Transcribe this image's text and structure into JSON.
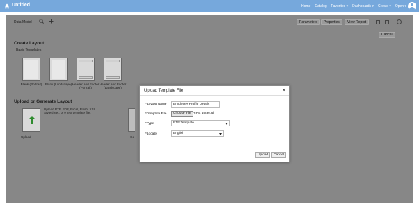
{
  "topbar": {
    "title": "Untitled",
    "nav": [
      "Home",
      "Catalog",
      "Favorites ▾",
      "Dashboards ▾",
      "Create ▾",
      "Open ▾"
    ]
  },
  "toolbar": {
    "data_model_label": "Data Model",
    "parameters": "Parameters",
    "properties": "Properties",
    "view_report": "View Report",
    "cancel": "Cancel"
  },
  "create_layout": {
    "title": "Create Layout",
    "subtitle": "Basic Templates",
    "templates": [
      {
        "label": "Blank (Portrait)"
      },
      {
        "label": "Blank (Landscape)"
      },
      {
        "label": "Header and Footer (Portrait)"
      },
      {
        "label": "Header and Footer (Landscape)"
      }
    ]
  },
  "upload_section": {
    "title": "Upload or Generate Layout",
    "description": "Upload RTF, PDF, Excel, Flash, XSL Stylesheet, or eText template file.",
    "upload_label": "Upload",
    "generate_label": "Ge"
  },
  "dialog": {
    "title": "Upload Template File",
    "layout_name_label": "*Layout Name",
    "layout_name_value": "Employee Profile Details",
    "template_file_label": "*Template File",
    "choose_file_label": "Choose File",
    "file_name": "HIRE Letter.rtf",
    "type_label": "*Type",
    "type_value": "RTF Template",
    "locale_label": "*Locale",
    "locale_value": "English",
    "upload_button": "Upload",
    "cancel_button": "Cancel"
  },
  "colors": {
    "topbar": "#76a8dc",
    "overlay": "#878787",
    "dialog_bg": "#ffffff"
  }
}
